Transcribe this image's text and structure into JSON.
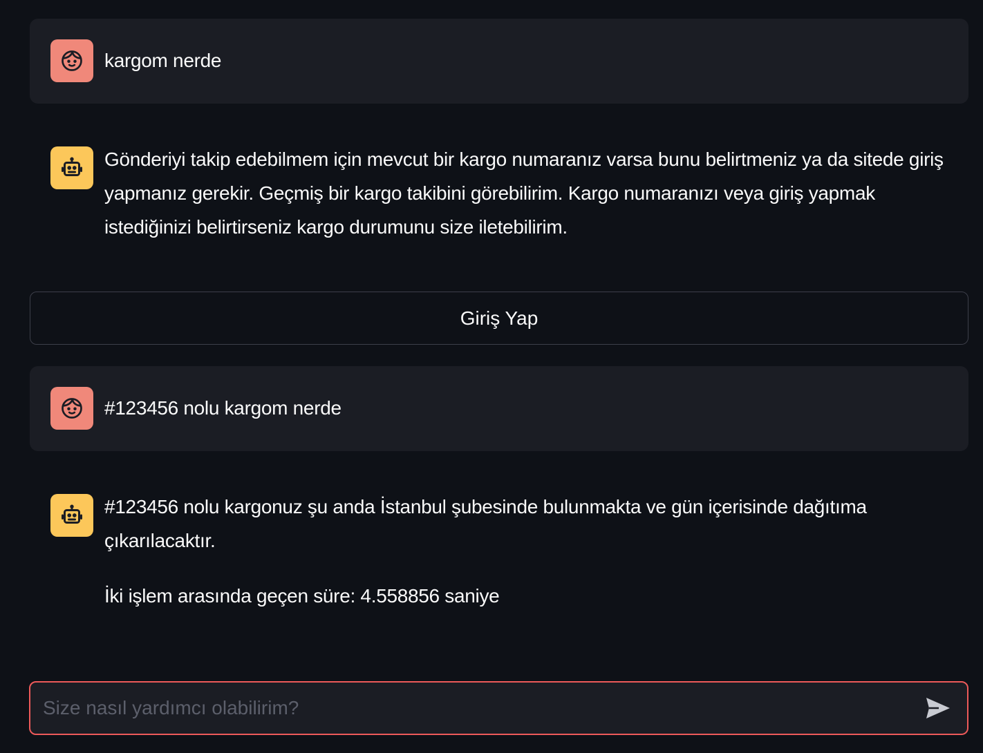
{
  "messages": [
    {
      "role": "user",
      "avatar_icon": "user-face-icon",
      "paragraphs": [
        "kargom nerde"
      ]
    },
    {
      "role": "assistant",
      "avatar_icon": "robot-icon",
      "paragraphs": [
        "Gönderiyi takip edebilmem için mevcut bir kargo numaranız varsa bunu belirtmeniz ya da sitede giriş yapmanız gerekir. Geçmiş bir kargo takibini görebilirim. Kargo numaranızı veya giriş yapmak istediğinizi belirtirseniz kargo durumunu size iletebilirim."
      ]
    },
    {
      "role": "user",
      "avatar_icon": "user-face-icon",
      "paragraphs": [
        "#123456 nolu kargom nerde"
      ]
    },
    {
      "role": "assistant",
      "avatar_icon": "robot-icon",
      "paragraphs": [
        "#123456 nolu kargonuz şu anda İstanbul şubesinde bulunmakta ve gün içerisinde dağıtıma çıkarılacaktır.",
        "İki işlem arasında geçen süre: 4.558856 saniye"
      ]
    }
  ],
  "login_button": {
    "label": "Giriş Yap"
  },
  "chat_input": {
    "placeholder": "Size nasıl yardımcı olabilirim?",
    "value": ""
  },
  "colors": {
    "background": "#0e1117",
    "user_message_bg": "#1b1d24",
    "user_avatar": "#f0887a",
    "bot_avatar": "#fcc75a",
    "input_border": "#ee5a5a"
  }
}
